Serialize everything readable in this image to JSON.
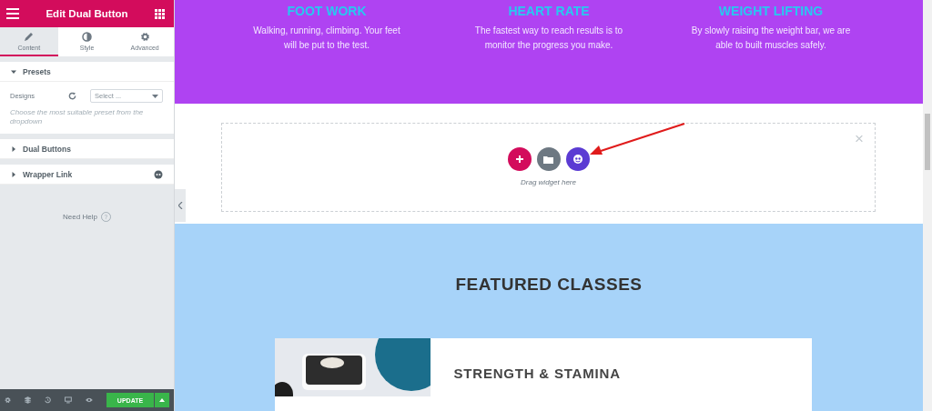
{
  "panel": {
    "title": "Edit Dual Button",
    "tabs": [
      {
        "label": "Content",
        "selected": true
      },
      {
        "label": "Style",
        "selected": false
      },
      {
        "label": "Advanced",
        "selected": false
      }
    ],
    "sections": [
      {
        "title": "Presets",
        "expanded": true,
        "field": {
          "label": "Designs",
          "placeholder": "Select ...",
          "hint": "Choose the most suitable preset from the dropdown"
        }
      },
      {
        "title": "Dual Buttons",
        "expanded": false
      },
      {
        "title": "Wrapper Link",
        "expanded": false,
        "badge": true
      }
    ],
    "help": "Need Help",
    "help_icon": "?",
    "footer": {
      "update": "UPDATE"
    }
  },
  "features": [
    {
      "title": "FOOT WORK",
      "text": "Walking, running, climbing. Your feet will be put to the test."
    },
    {
      "title": "HEART RATE",
      "text": "The fastest way to reach results is to monitor the progress you make."
    },
    {
      "title": "WEIGHT LIFTING",
      "text": "By slowly raising the weight bar, we are able to built muscles safely."
    }
  ],
  "dropzone": {
    "text": "Drag widget here",
    "close": "×"
  },
  "featured": {
    "heading": "FEATURED CLASSES",
    "card": {
      "title": "STRENGTH & STAMINA"
    }
  }
}
